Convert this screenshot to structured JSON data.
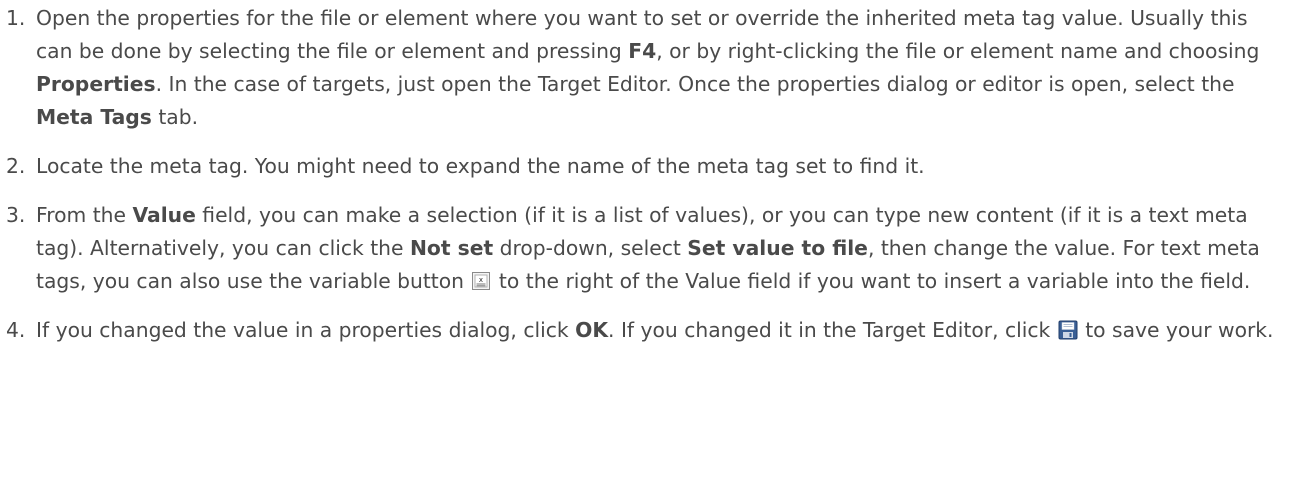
{
  "steps": [
    {
      "number": "1.",
      "parts": [
        "Open the properties for the file or element where you want to set or override the inherited meta tag value. Usually this can be done by selecting the file or element and pressing ",
        "F4",
        ", or by right-clicking the file or element name and choosing ",
        "Properties",
        ". In the case of targets, just open the Target Editor. Once the properties dialog or editor is open, select the ",
        "Meta Tags",
        " tab."
      ]
    },
    {
      "number": "2.",
      "parts": [
        "Locate the meta tag. You might need to expand the name of the meta tag set to find it."
      ]
    },
    {
      "number": "3.",
      "parts": [
        "From the ",
        "Value",
        " field, you can make a selection (if it is a list of values), or you can type new content (if it is a text meta tag). Alternatively, you can click the ",
        "Not set",
        " drop-down, select ",
        "Set value to file",
        ", then change the value. For text meta tags, you can also use the variable button ",
        " to the right of the Value field if you want to insert a variable into the field."
      ],
      "icon": "insert-variable-icon"
    },
    {
      "number": "4.",
      "parts": [
        "If you changed the value in a properties dialog, click ",
        "OK",
        ". If you changed it in the Target Editor, click ",
        " to save your work."
      ],
      "icon": "save-icon"
    }
  ]
}
